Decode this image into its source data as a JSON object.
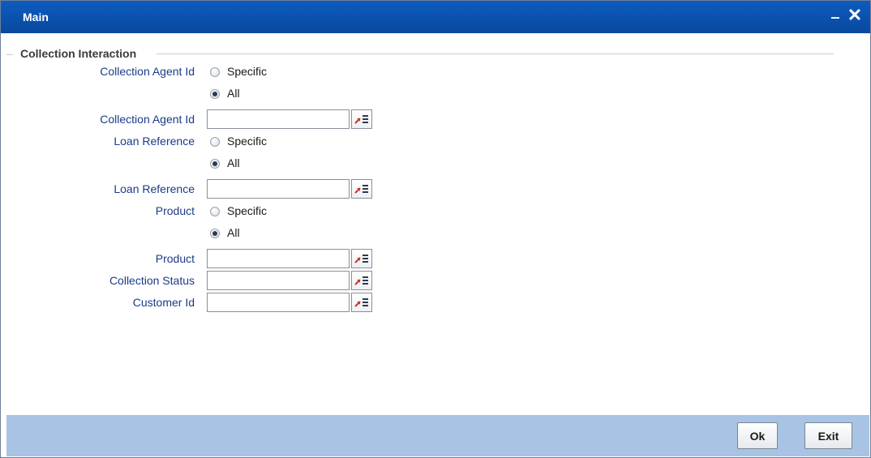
{
  "window": {
    "title": "Main",
    "minimize_symbol": "‒",
    "close_symbol": "✕"
  },
  "section": {
    "legend": "Collection Interaction"
  },
  "form": {
    "collection_agent_option": {
      "label": "Collection Agent Id",
      "specific": "Specific",
      "all": "All",
      "selected": "All"
    },
    "collection_agent_field": {
      "label": "Collection Agent Id",
      "value": ""
    },
    "loan_reference_option": {
      "label": "Loan Reference",
      "specific": "Specific",
      "all": "All",
      "selected": "All"
    },
    "loan_reference_field": {
      "label": "Loan Reference",
      "value": ""
    },
    "product_option": {
      "label": "Product",
      "specific": "Specific",
      "all": "All",
      "selected": "All"
    },
    "product_field": {
      "label": "Product",
      "value": ""
    },
    "collection_status_field": {
      "label": "Collection Status",
      "value": ""
    },
    "customer_id_field": {
      "label": "Customer Id",
      "value": ""
    }
  },
  "footer": {
    "ok_label": "Ok",
    "exit_label": "Exit"
  },
  "icons": {
    "lov": "list-of-values-icon"
  },
  "colors": {
    "titlebar": "#0a52b2",
    "footer": "#a8c3e4",
    "label_text": "#1a3a8a",
    "lov_arrow": "#d2321e"
  }
}
